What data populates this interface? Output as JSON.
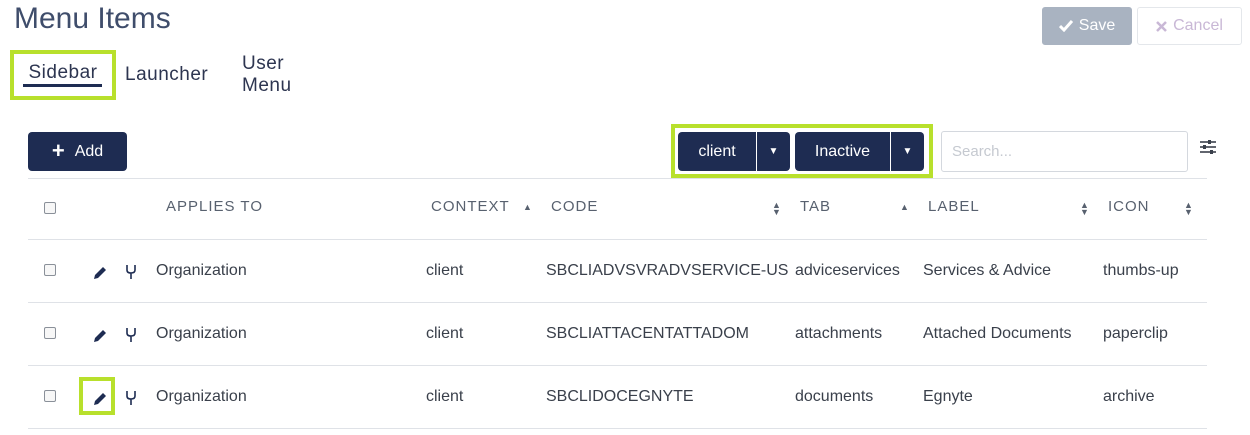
{
  "page": {
    "title": "Menu Items"
  },
  "actions": {
    "save_label": "Save",
    "cancel_label": "Cancel",
    "save_icon": "check-icon",
    "cancel_icon": "x-icon"
  },
  "tabs": [
    {
      "label": "Sidebar",
      "active": true
    },
    {
      "label": "Launcher",
      "active": false
    },
    {
      "label": "User Menu",
      "active": false
    }
  ],
  "toolbar": {
    "add_label": "Add",
    "context_filter": "client",
    "status_filter": "Inactive",
    "search_placeholder": "Search...",
    "settings_icon": "sliders-icon"
  },
  "table": {
    "columns": [
      "APPLIES TO",
      "CONTEXT",
      "CODE",
      "TAB",
      "LABEL",
      "ICON"
    ],
    "rows": [
      {
        "applies_to": "Organization",
        "context": "client",
        "code": "SBCLIADVSVRADVSERVICE-US",
        "tab": "adviceservices",
        "label": "Services & Advice",
        "icon": "thumbs-up"
      },
      {
        "applies_to": "Organization",
        "context": "client",
        "code": "SBCLIATTACENTATTADOM",
        "tab": "attachments",
        "label": "Attached Documents",
        "icon": "paperclip"
      },
      {
        "applies_to": "Organization",
        "context": "client",
        "code": "SBCLIDOCEGNYTE",
        "tab": "documents",
        "label": "Egnyte",
        "icon": "archive"
      }
    ]
  },
  "colors": {
    "primary": "#1e2c52",
    "highlight": "#b8e02c",
    "save_disabled": "#a9b3c1"
  }
}
